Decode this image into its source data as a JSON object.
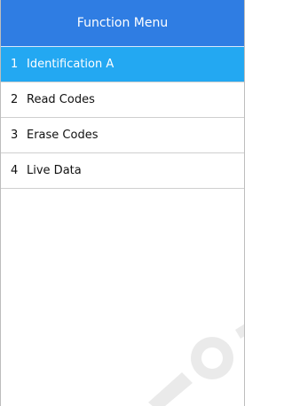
{
  "colors": {
    "header_bg": "#2f7de3",
    "selected_bg": "#23a8f2"
  },
  "header": {
    "title": "Function Menu"
  },
  "menu": {
    "items": [
      {
        "number": "1",
        "label": "Identification A",
        "selected": true
      },
      {
        "number": "2",
        "label": "Read Codes",
        "selected": false
      },
      {
        "number": "3",
        "label": "Erase Codes",
        "selected": false
      },
      {
        "number": "4",
        "label": "Live Data",
        "selected": false
      }
    ]
  }
}
